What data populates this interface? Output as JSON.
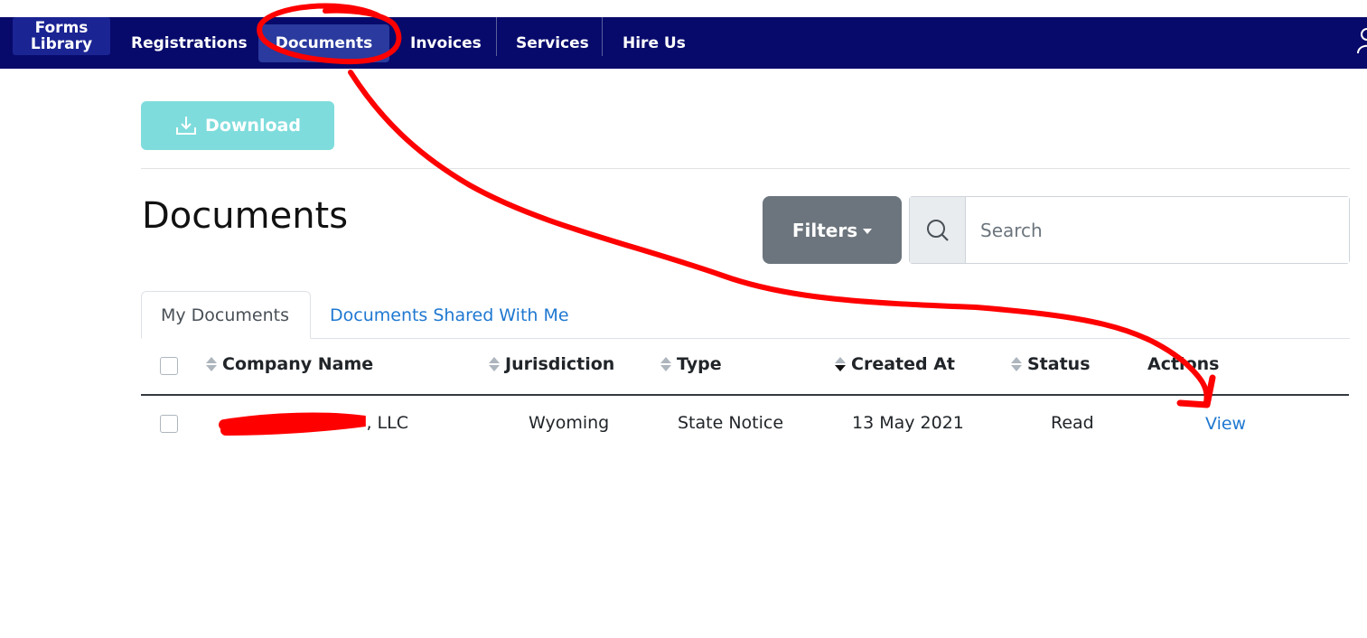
{
  "nav": {
    "forms_line1": "Forms",
    "forms_line2": "Library",
    "items": [
      {
        "label": "Registrations"
      },
      {
        "label": "Documents"
      },
      {
        "label": "Invoices"
      },
      {
        "label": "Services"
      },
      {
        "label": "Hire Us"
      }
    ],
    "active_item": "Documents",
    "user_icon": "user-icon"
  },
  "toolbar": {
    "download_label": "Download",
    "download_icon": "download-icon"
  },
  "page": {
    "title": "Documents"
  },
  "filters": {
    "label": "Filters"
  },
  "search": {
    "placeholder": "Search",
    "value": "",
    "icon": "search-icon"
  },
  "tabs": [
    {
      "label": "My Documents",
      "active": true
    },
    {
      "label": "Documents Shared With Me",
      "active": false
    }
  ],
  "table": {
    "columns": [
      "Company Name",
      "Jurisdiction",
      "Type",
      "Created At",
      "Status",
      "Actions"
    ],
    "sorted_column": "Created At",
    "rows": [
      {
        "company_name": ", LLC",
        "jurisdiction": "Wyoming",
        "type": "State Notice",
        "created_at": "13 May 2021",
        "status": "Read",
        "action": "View"
      }
    ]
  },
  "colors": {
    "navbar": "#070a6b",
    "download_button": "#7fdcdc",
    "filters_button": "#6c757d",
    "link": "#1f78d1",
    "annotation": "#ff0000"
  }
}
